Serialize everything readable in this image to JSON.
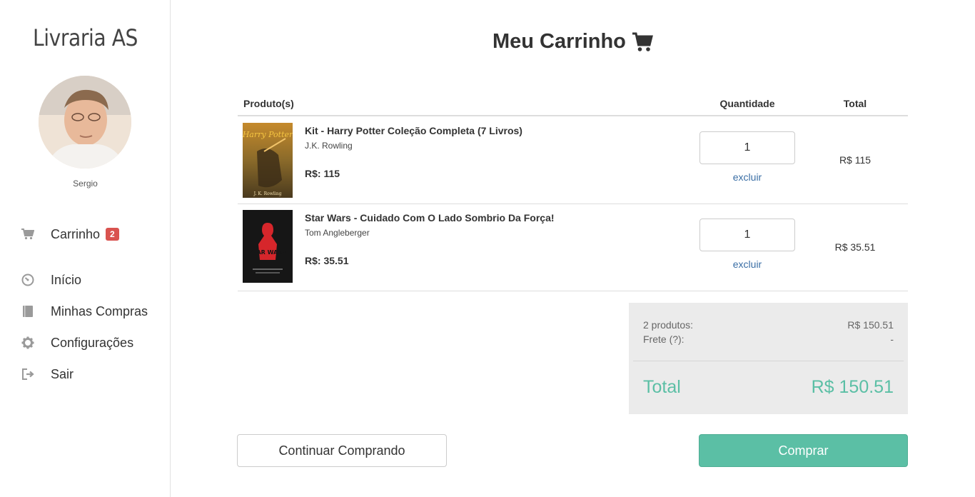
{
  "sidebar": {
    "brand": "Livraria AS",
    "username": "Sergio",
    "nav": {
      "cart": {
        "label": "Carrinho",
        "badge": "2",
        "icon": "cart-icon"
      },
      "home": {
        "label": "Início",
        "icon": "dashboard-icon"
      },
      "purchases": {
        "label": "Minhas Compras",
        "icon": "book-icon"
      },
      "settings": {
        "label": "Configurações",
        "icon": "gear-icon"
      },
      "logout": {
        "label": "Sair",
        "icon": "sign-out-icon"
      }
    }
  },
  "main": {
    "title": "Meu Carrinho",
    "title_icon": "shopping-cart-icon",
    "columns": {
      "product": "Produto(s)",
      "quantity": "Quantidade",
      "total": "Total"
    },
    "items": [
      {
        "name": "Kit - Harry Potter Coleção Completa (7 Livros)",
        "author": "J.K. Rowling",
        "price": "R$: 115",
        "quantity": "1",
        "remove": "excluir",
        "total": "R$ 115",
        "cover": {
          "title_line1": "Harry Potter",
          "author": "J. K. Rowling"
        }
      },
      {
        "name": "Star Wars - Cuidado Com O Lado Sombrio Da Força!",
        "author": "Tom Angleberger",
        "price": "R$: 35.51",
        "quantity": "1",
        "remove": "excluir",
        "total": "R$ 35.51",
        "cover": {
          "logo": "STAR WARS"
        }
      }
    ],
    "summary": {
      "products_label": "2 produtos:",
      "products_value": "R$ 150.51",
      "shipping_label": "Frete (?):",
      "shipping_value": "-",
      "total_label": "Total",
      "total_value": "R$ 150.51"
    },
    "buttons": {
      "continue": "Continuar Comprando",
      "buy": "Comprar"
    }
  },
  "colors": {
    "accent": "#5bbfa5",
    "badge": "#d9534f",
    "link": "#3a6ea5",
    "summary_bg": "#ebebeb"
  }
}
